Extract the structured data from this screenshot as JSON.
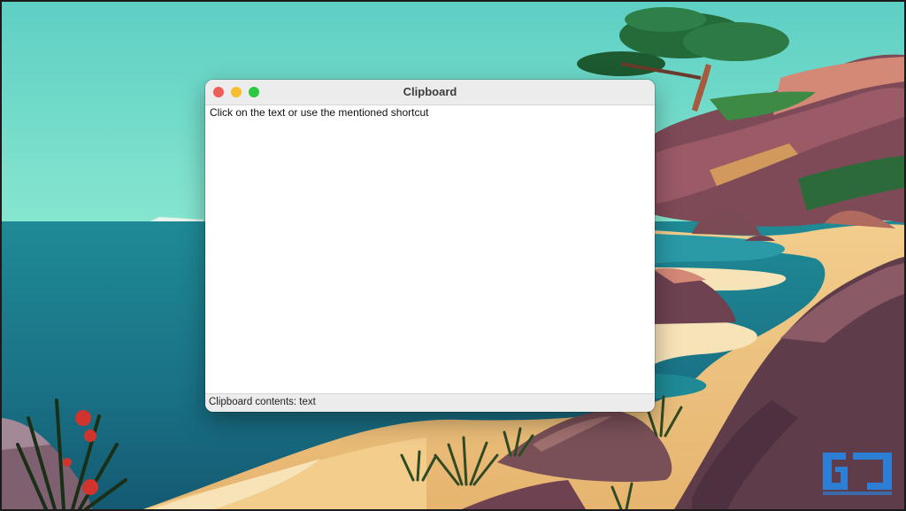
{
  "window": {
    "title": "Clipboard",
    "instruction": "Click on the text or use the mentioned shortcut",
    "status": "Clipboard contents: text"
  },
  "traffic_lights": {
    "close": "#ee5f57",
    "minimize": "#f5bd2f",
    "maximize": "#2ac940"
  },
  "watermark": {
    "logo": "GJ",
    "text": "GADGETS TO USE"
  }
}
